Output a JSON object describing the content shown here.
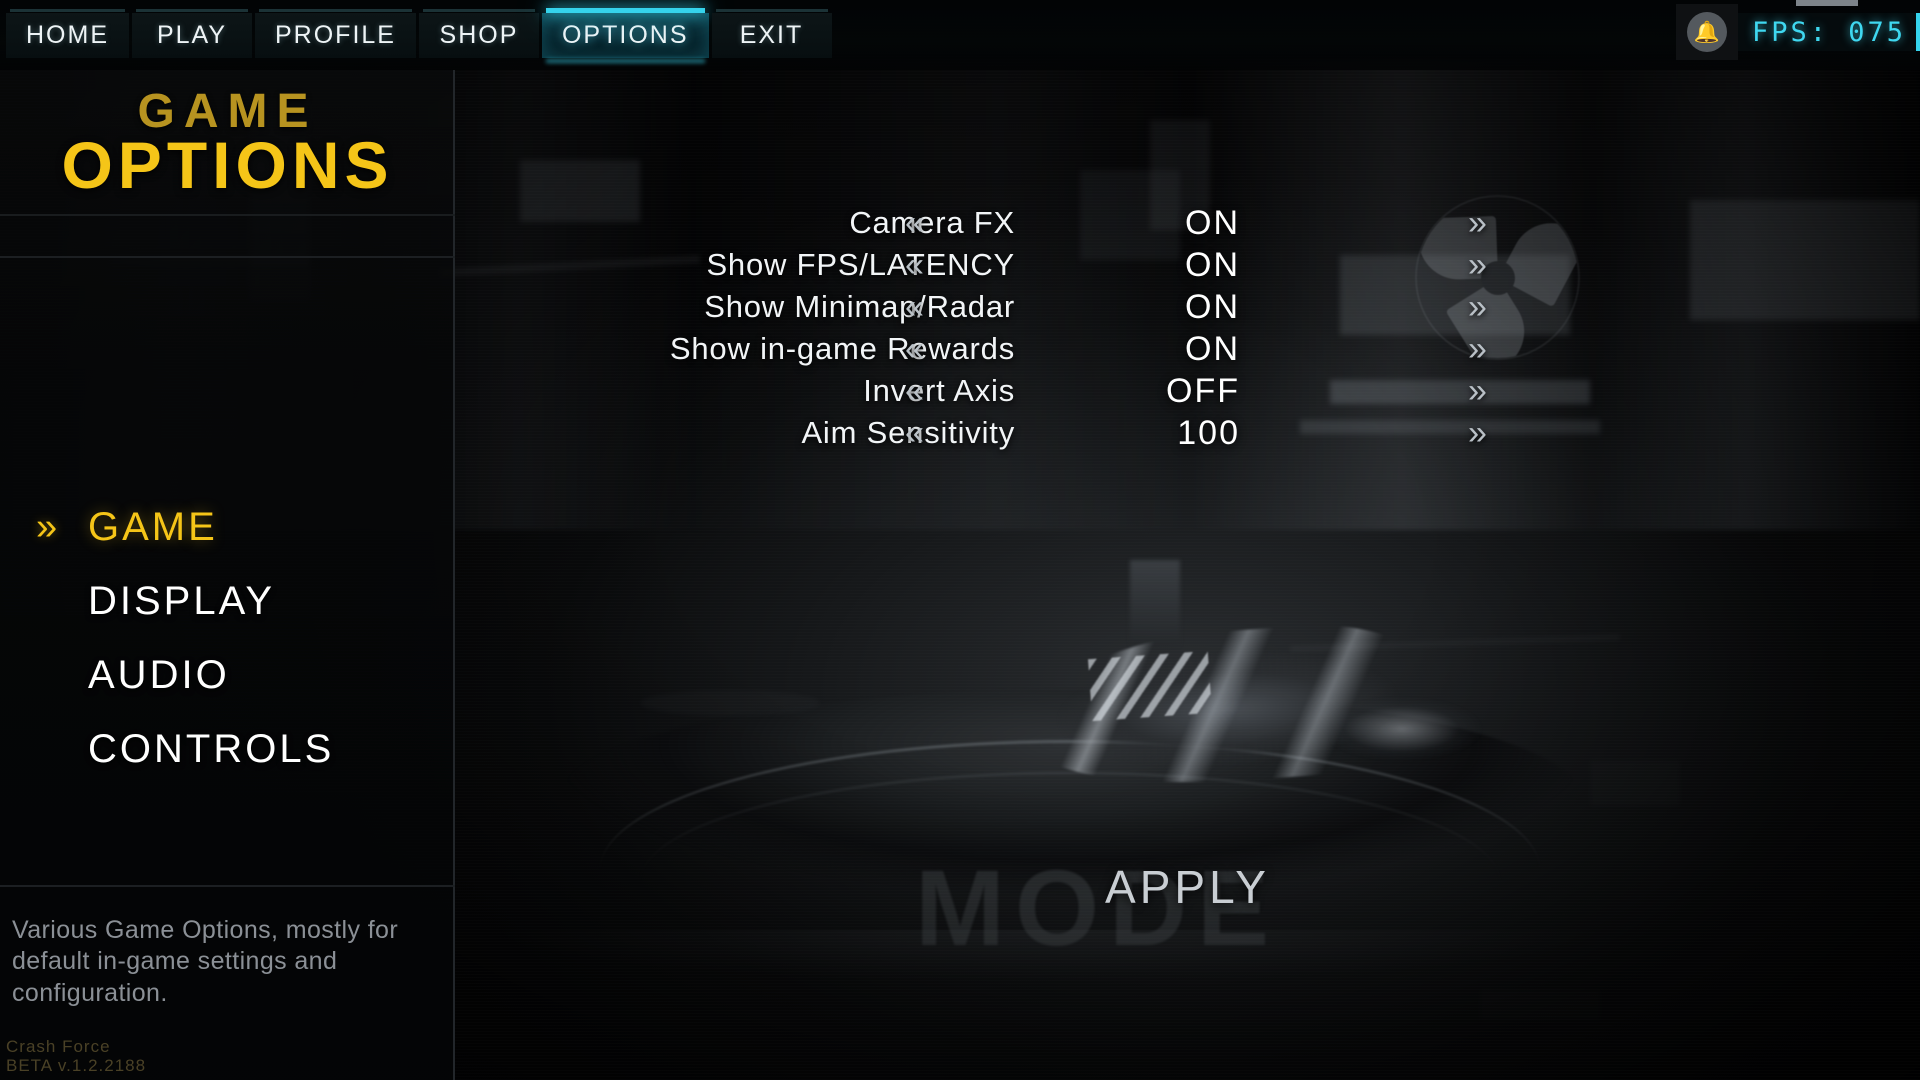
{
  "app": {
    "game_title": "Crash Force",
    "version": "BETA v.1.2.2188"
  },
  "topnav": {
    "items": [
      {
        "label": "HOME",
        "active": false
      },
      {
        "label": "PLAY",
        "active": false
      },
      {
        "label": "PROFILE",
        "active": false
      },
      {
        "label": "SHOP",
        "active": false
      },
      {
        "label": "OPTIONS",
        "active": true
      },
      {
        "label": "EXIT",
        "active": false
      }
    ],
    "hud": {
      "bell_icon": "bell-icon",
      "fps_label": "FPS: 075",
      "accent_color": "#35d3ec"
    }
  },
  "sidebar": {
    "title_top": "GAME",
    "title_main": "OPTIONS",
    "title_top_color": "#b79320",
    "title_main_color": "#f5c518",
    "selected_chevron": "»",
    "items": [
      {
        "label": "GAME",
        "active": true
      },
      {
        "label": "DISPLAY",
        "active": false
      },
      {
        "label": "AUDIO",
        "active": false
      },
      {
        "label": "CONTROLS",
        "active": false
      }
    ],
    "description": "Various Game Options, mostly for default in-game settings and configuration."
  },
  "settings": {
    "arrow_left": "«",
    "arrow_right": "»",
    "rows": [
      {
        "label": "Camera FX",
        "value": "ON"
      },
      {
        "label": "Show FPS/LATENCY",
        "value": "ON"
      },
      {
        "label": "Show Minimap/Radar",
        "value": "ON"
      },
      {
        "label": "Show in-game Rewards",
        "value": "ON"
      },
      {
        "label": "Invert Axis",
        "value": "OFF"
      },
      {
        "label": "Aim Sensitivity",
        "value": "100"
      }
    ],
    "apply_label": "APPLY"
  },
  "background": {
    "platform_text": "MODE"
  }
}
